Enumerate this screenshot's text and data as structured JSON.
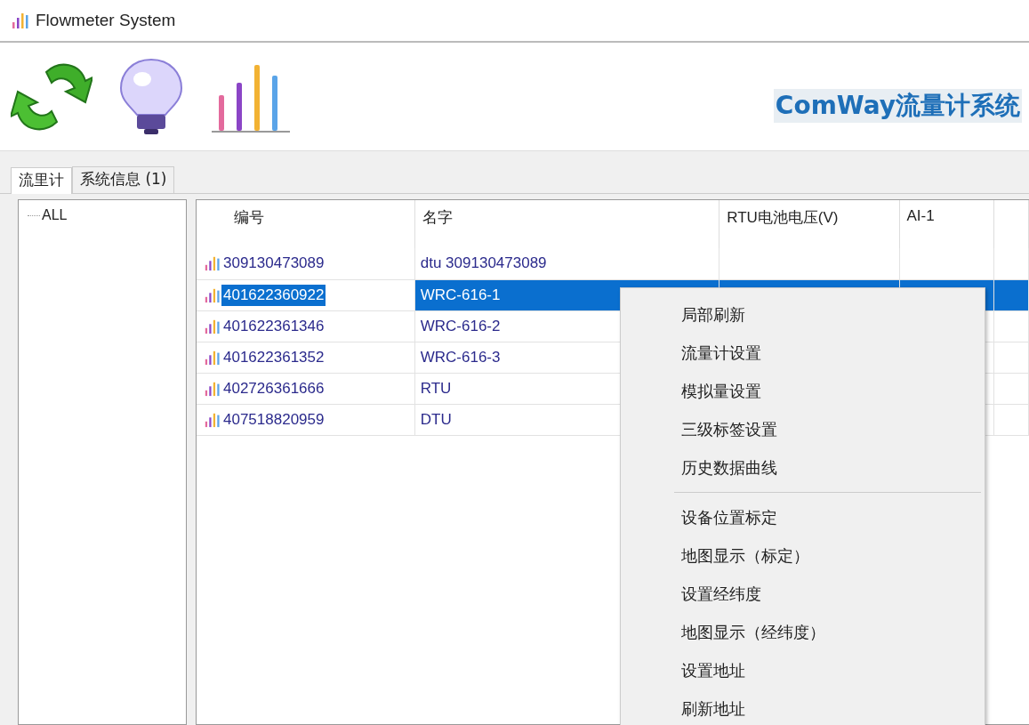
{
  "window": {
    "title": "Flowmeter System"
  },
  "banner": {
    "text": "ComWay流量计系统"
  },
  "tabs": [
    {
      "label": "流里计",
      "selected": true
    },
    {
      "label": "系统信息 (1)",
      "selected": false
    }
  ],
  "tree": {
    "items": [
      {
        "label": "ALL"
      }
    ]
  },
  "table": {
    "columns": [
      "编号",
      "名字",
      "RTU电池电压(V)",
      "AI-1"
    ],
    "rows": [
      {
        "id": "309130473089",
        "name": "dtu 309130473089",
        "selected": false
      },
      {
        "id": "401622360922",
        "name": "WRC-616-1",
        "selected": true
      },
      {
        "id": "401622361346",
        "name": "WRC-616-2",
        "selected": false
      },
      {
        "id": "401622361352",
        "name": "WRC-616-3",
        "selected": false
      },
      {
        "id": "402726361666",
        "name": "RTU",
        "selected": false
      },
      {
        "id": "407518820959",
        "name": "DTU",
        "selected": false
      }
    ]
  },
  "context_menu": {
    "items": [
      {
        "kind": "item",
        "label": "局部刷新"
      },
      {
        "kind": "item",
        "label": "流量计设置"
      },
      {
        "kind": "item",
        "label": "模拟量设置"
      },
      {
        "kind": "item",
        "label": "三级标签设置"
      },
      {
        "kind": "item",
        "label": "历史数据曲线"
      },
      {
        "kind": "separator"
      },
      {
        "kind": "item",
        "label": "设备位置标定"
      },
      {
        "kind": "item",
        "label": "地图显示（标定）"
      },
      {
        "kind": "item",
        "label": "设置经纬度"
      },
      {
        "kind": "item",
        "label": "地图显示（经纬度）"
      },
      {
        "kind": "item",
        "label": "设置地址"
      },
      {
        "kind": "item",
        "label": "刷新地址"
      }
    ]
  }
}
